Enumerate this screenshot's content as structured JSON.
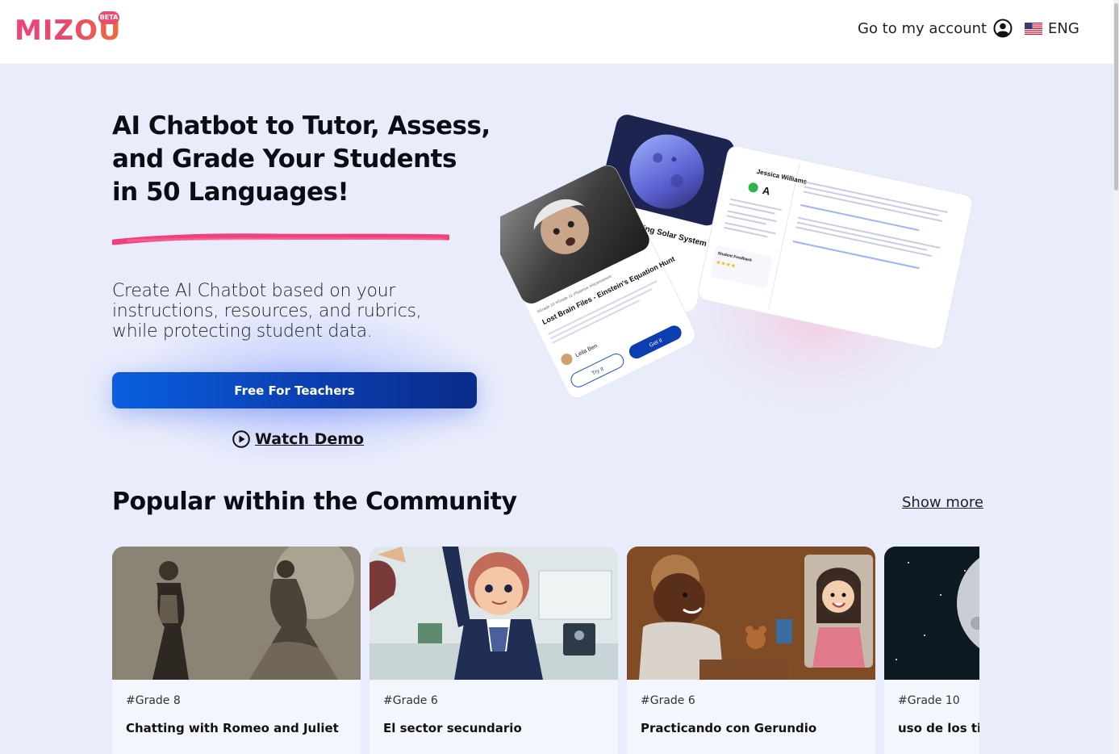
{
  "header": {
    "logo_text": "MIZOU",
    "beta_badge": "BETA",
    "account_label": "Go to my account",
    "language_label": "ENG"
  },
  "hero": {
    "title_line1": "AI Chatbot to Tutor, Assess,",
    "title_line2": "and Grade Your Students",
    "title_line3": "in 50 Languages!",
    "subtitle_line1": "Create AI Chatbot based on your",
    "subtitle_line2": "instructions, resources, and rubrics,",
    "subtitle_line3": "while protecting student data.",
    "cta_label": "Free For Teachers",
    "demo_label": "Watch Demo"
  },
  "illustration": {
    "card_title": "Lost Brain Files - Einstein's Equation Hunt",
    "card_tags": "#Grade 10  #Grade 11  #Science  #Assessment",
    "card_author": "Leila Ben",
    "try_label": "Try it",
    "get_label": "Get it",
    "quest_title": "Quest - Decoding Solar System",
    "student_name": "Jessica Williams",
    "grade": "A",
    "feedback_label": "Student Feedback"
  },
  "community": {
    "title": "Popular within the Community",
    "show_more": "Show more",
    "cards": [
      {
        "tag": "#Grade 8",
        "title": "Chatting with Romeo and Juliet"
      },
      {
        "tag": "#Grade 6",
        "title": "El sector secundario"
      },
      {
        "tag": "#Grade 6",
        "title": "Practicando con Gerundio"
      },
      {
        "tag": "#Grade 10",
        "title": "uso de los tiempos espanol"
      }
    ]
  },
  "colors": {
    "brand_pink": "#ea4d6f",
    "cta_blue": "#0b3eb0",
    "page_bg": "#e9ecfb"
  }
}
